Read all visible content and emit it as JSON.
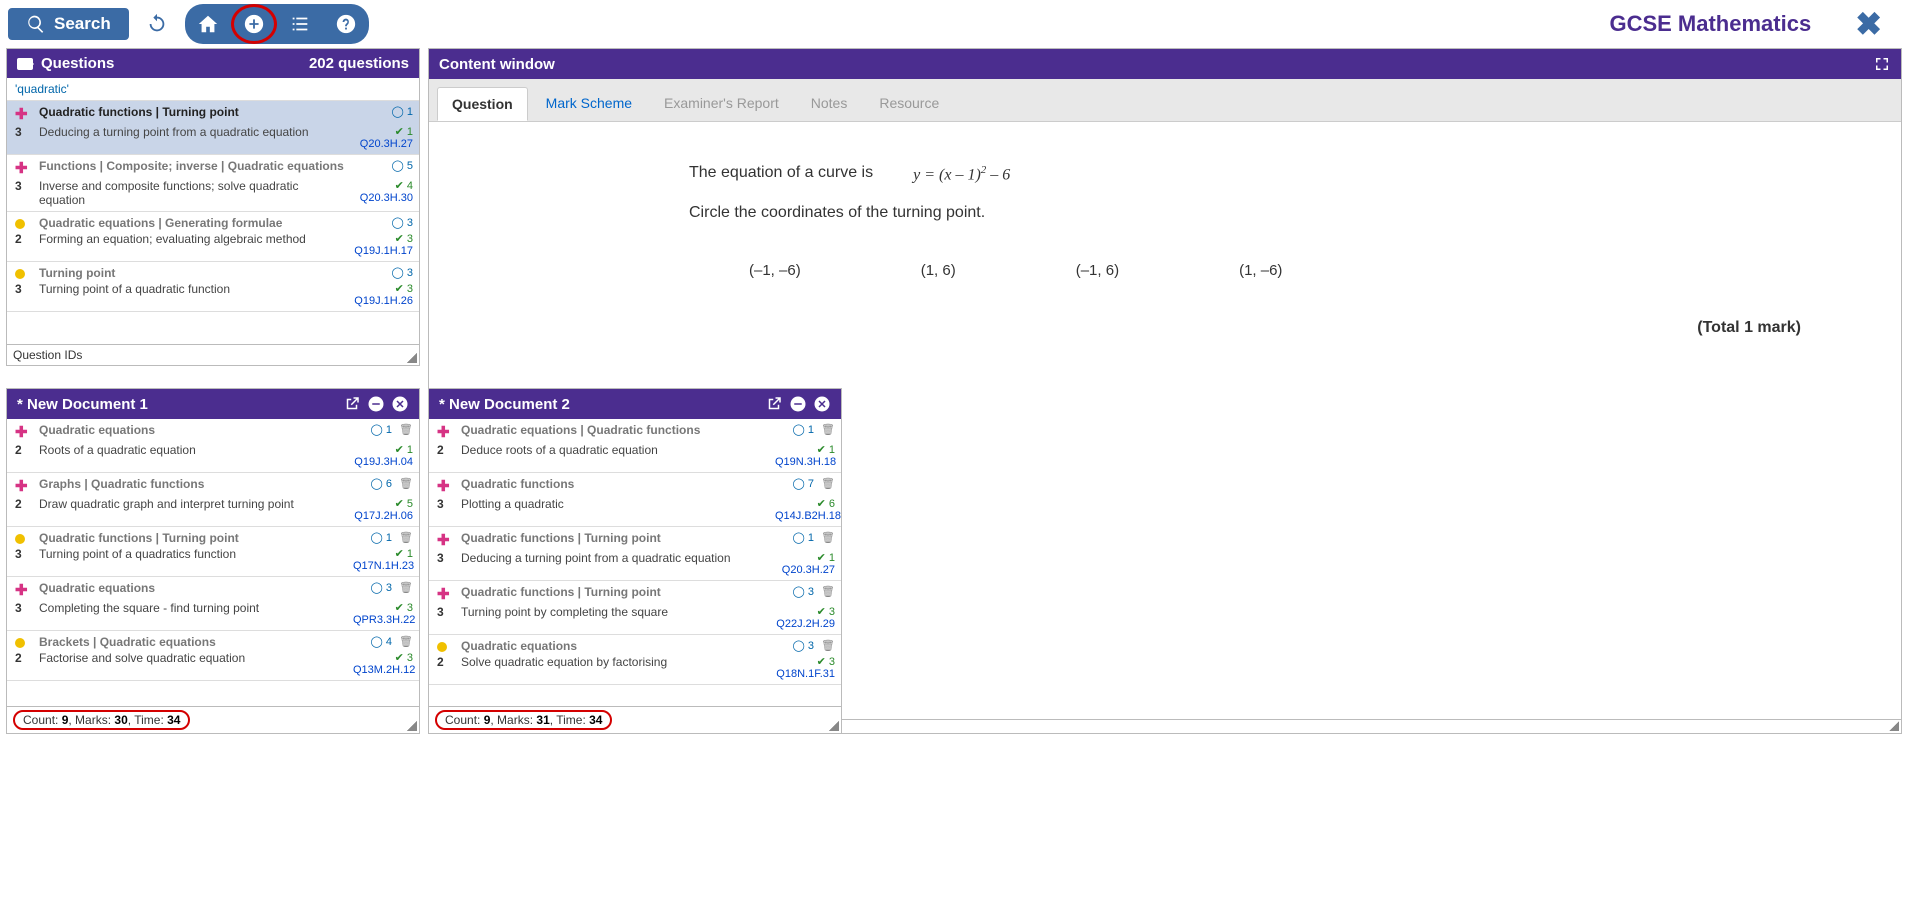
{
  "toolbar": {
    "search": "Search"
  },
  "brand": "GCSE Mathematics",
  "questions": {
    "title": "Questions",
    "count_label": "202 questions",
    "filter": "'quadratic'",
    "footer": "Question IDs",
    "items": [
      {
        "icon": "plus",
        "title": "Quadratic functions | Turning point",
        "diff": "3",
        "desc": "Deducing a turning point from a quadratic equation",
        "m": "1",
        "c": "1",
        "id": "Q20.3H.27",
        "sel": true
      },
      {
        "icon": "plus",
        "title": "Functions | Composite; inverse | Quadratic equations",
        "diff": "3",
        "desc": "Inverse and composite functions; solve quadratic equation",
        "m": "5",
        "c": "4",
        "id": "Q20.3H.30"
      },
      {
        "icon": "dot",
        "title": "Quadratic equations | Generating formulae",
        "diff": "2",
        "desc": "Forming an equation; evaluating algebraic method",
        "m": "3",
        "c": "3",
        "id": "Q19J.1H.17"
      },
      {
        "icon": "dot",
        "title": "Turning point",
        "diff": "3",
        "desc": "Turning point of a quadratic function",
        "m": "3",
        "c": "3",
        "id": "Q19J.1H.26"
      }
    ]
  },
  "content": {
    "title": "Content window",
    "tabs": [
      "Question",
      "Mark Scheme",
      "Examiner's Report",
      "Notes",
      "Resource"
    ],
    "eq_intro": "The equation of a curve is",
    "eq": "y = (x – 1)² – 6",
    "instr": "Circle the coordinates of the turning point.",
    "options": [
      "(–1, –6)",
      "(1, 6)",
      "(–1, 6)",
      "(1, –6)"
    ],
    "total": "(Total 1 mark)"
  },
  "doc1": {
    "title": "* New Document 1",
    "items": [
      {
        "icon": "plus",
        "title": "Quadratic equations",
        "diff": "2",
        "desc": "Roots of a quadratic equation",
        "m": "1",
        "c": "1",
        "id": "Q19J.3H.04"
      },
      {
        "icon": "plus",
        "title": "Graphs | Quadratic functions",
        "diff": "2",
        "desc": "Draw quadratic graph and interpret turning point",
        "m": "6",
        "c": "5",
        "id": "Q17J.2H.06"
      },
      {
        "icon": "dot",
        "title": "Quadratic functions | Turning point",
        "diff": "3",
        "desc": "Turning point of a quadratics function",
        "m": "1",
        "c": "1",
        "id": "Q17N.1H.23"
      },
      {
        "icon": "plus",
        "title": "Quadratic equations",
        "diff": "3",
        "desc": "Completing the square - find turning point",
        "m": "3",
        "c": "3",
        "id": "QPR3.3H.22"
      },
      {
        "icon": "dot",
        "title": "Brackets | Quadratic equations",
        "diff": "2",
        "desc": "Factorise and solve quadratic equation",
        "m": "4",
        "c": "3",
        "id": "Q13M.2H.12"
      }
    ],
    "footer": {
      "count": "9",
      "marks": "30",
      "time": "34"
    }
  },
  "doc2": {
    "title": "* New Document 2",
    "items": [
      {
        "icon": "plus",
        "title": "Quadratic equations | Quadratic functions",
        "diff": "2",
        "desc": "Deduce roots of a quadratic equation",
        "m": "1",
        "c": "1",
        "id": "Q19N.3H.18"
      },
      {
        "icon": "plus",
        "title": "Quadratic functions",
        "diff": "3",
        "desc": "Plotting a quadratic",
        "m": "7",
        "c": "6",
        "id": "Q14J.B2H.18"
      },
      {
        "icon": "plus",
        "title": "Quadratic functions | Turning point",
        "diff": "3",
        "desc": "Deducing a turning point from a quadratic equation",
        "m": "1",
        "c": "1",
        "id": "Q20.3H.27"
      },
      {
        "icon": "plus",
        "title": "Quadratic functions | Turning point",
        "diff": "3",
        "desc": "Turning point by completing the square",
        "m": "3",
        "c": "3",
        "id": "Q22J.2H.29"
      },
      {
        "icon": "dot",
        "title": "Quadratic equations",
        "diff": "2",
        "desc": "Solve quadratic equation by factorising",
        "m": "3",
        "c": "3",
        "id": "Q18N.1F.31"
      }
    ],
    "footer": {
      "count": "9",
      "marks": "31",
      "time": "34"
    }
  },
  "labels": {
    "count": "Count:",
    "marks": "Marks:",
    "time": "Time:"
  }
}
